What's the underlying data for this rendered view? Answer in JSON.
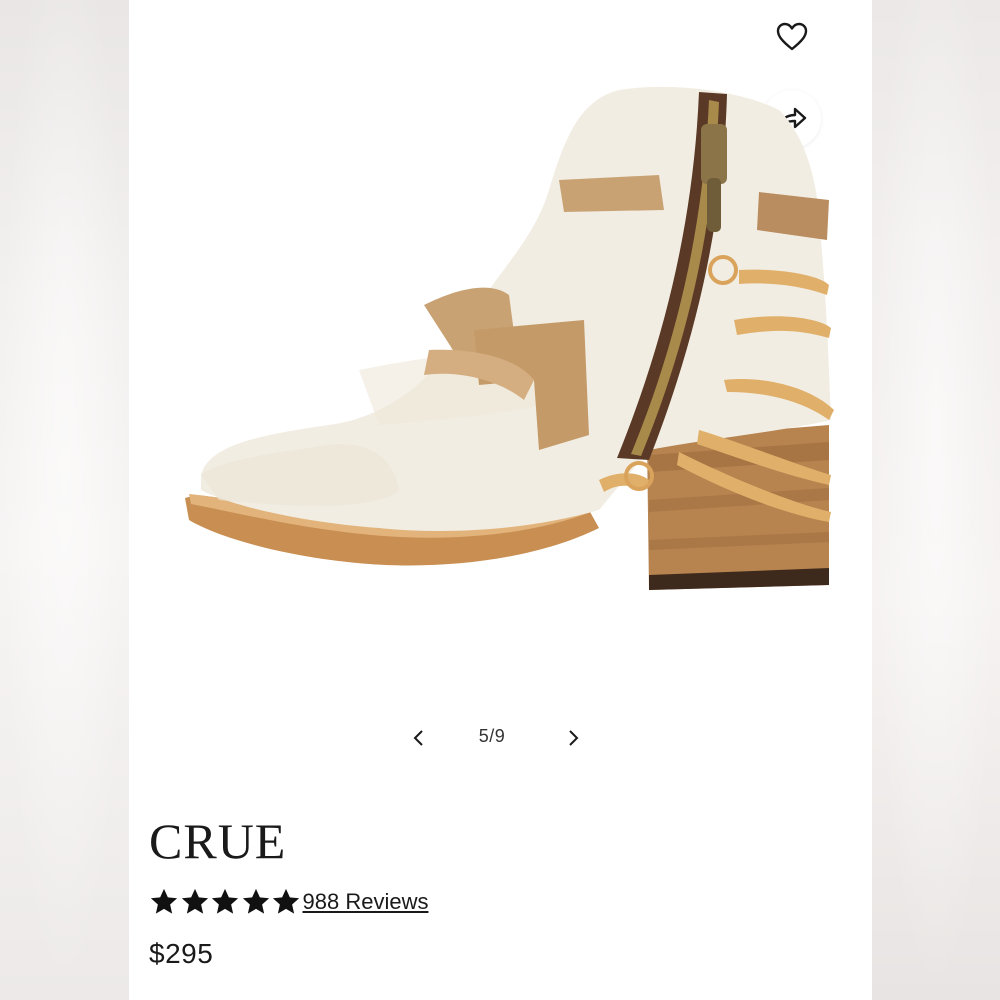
{
  "gallery": {
    "current": 5,
    "total": 9,
    "counter_text": "5/9",
    "image_alt": "Off-white leather ankle boot with side zipper, tan straps and wrapped laces on stacked wooden heel"
  },
  "icons": {
    "favorite": "heart-icon",
    "share": "share-icon",
    "prev": "chevron-left-icon",
    "next": "chevron-right-icon",
    "star": "star-icon"
  },
  "product": {
    "name": "CRUE",
    "rating": 5,
    "rating_max": 5,
    "reviews_text": "988 Reviews",
    "price": "$295"
  },
  "colors": {
    "text": "#1a1a1a",
    "background": "#ffffff"
  }
}
